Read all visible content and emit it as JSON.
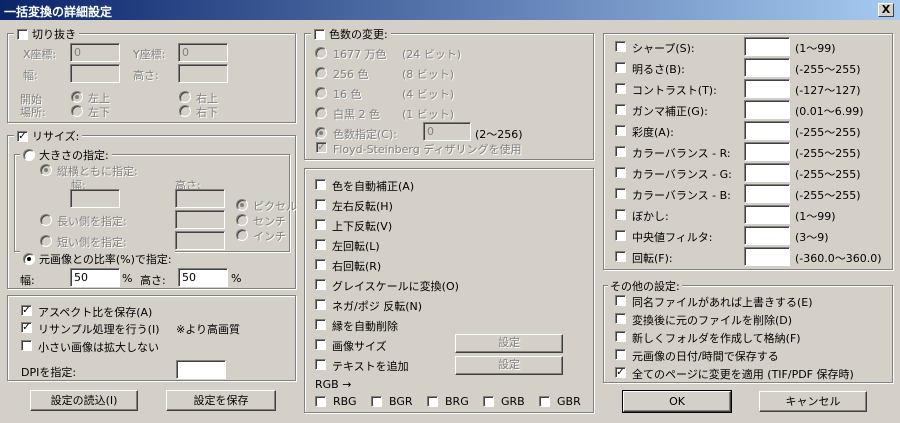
{
  "window": {
    "title": "一括変換の詳細設定",
    "close": "X"
  },
  "crop": {
    "label": "切り抜き",
    "x_label": "X座標:",
    "x_value": "0",
    "y_label": "Y座標:",
    "y_value": "0",
    "w_label": "幅:",
    "h_label": "高さ:",
    "start_label1": "開始",
    "start_label2": "場所:",
    "top_left": "左上",
    "top_right": "右上",
    "bottom_left": "左下",
    "bottom_right": "右下"
  },
  "resize": {
    "label": "リサイズ:",
    "size_spec": "大きさの指定:",
    "keep_wh": "縦横ともに指定:",
    "w_label": "幅:",
    "h_label": "高さ:",
    "long_side": "長い側を指定:",
    "short_side": "短い側を指定:",
    "unit_pixel": "ピクセル",
    "unit_cm": "センチ",
    "unit_inch": "インチ",
    "ratio_spec": "元画像との比率(%)で指定:",
    "ratio_w_label": "幅:",
    "ratio_w": "50",
    "pct1": "%",
    "ratio_h_label": "高さ:",
    "ratio_h": "50",
    "pct2": "%"
  },
  "aspect": {
    "keep_aspect": "アスペクト比を保存(A)",
    "resample": "リサンプル処理を行う(I)",
    "note": "※より高画質",
    "no_enlarge": "小さい画像は拡大しない",
    "dpi_label": "DPIを指定:",
    "dpi_value": ""
  },
  "buttons_left": {
    "load": "設定の読込(I)",
    "save": "設定を保存"
  },
  "colors": {
    "label": "色数の変更:",
    "c1677": "1677 万色",
    "c1677b": "(24 ビット)",
    "c256": "256 色",
    "c256b": "(8 ビット)",
    "c16": "16 色",
    "c16b": "(4 ビット)",
    "c2": "白黒 2 色",
    "c2b": "(1 ビット)",
    "spec": "色数指定(C):",
    "spec_value": "0",
    "spec_range": "(2〜256)",
    "floyd": "Floyd-Steinberg ディザリングを使用"
  },
  "ops": {
    "auto_color": "色を自動補正(A)",
    "flip_h": "左右反転(H)",
    "flip_v": "上下反転(V)",
    "rot_l": "左回転(L)",
    "rot_r": "右回転(R)",
    "gray": "グレイスケールに変換(O)",
    "nega": "ネガ/ポジ 反転(N)",
    "trim": "縁を自動削除",
    "img_size": "画像サイズ",
    "add_text": "テキストを追加",
    "settings": "設定",
    "rgb_label": "RGB →",
    "rbg": "RBG",
    "bgr": "BGR",
    "brg": "BRG",
    "grb": "GRB",
    "gbr": "GBR"
  },
  "adjust": [
    {
      "label": "シャープ(S):",
      "range": "(1〜99)"
    },
    {
      "label": "明るさ(B):",
      "range": "(-255〜255)"
    },
    {
      "label": "コントラスト(T):",
      "range": "(-127〜127)"
    },
    {
      "label": "ガンマ補正(G):",
      "range": "(0.01〜6.99)"
    },
    {
      "label": "彩度(A):",
      "range": "(-255〜255)"
    },
    {
      "label": "カラーバランス - R:",
      "range": "(-255〜255)"
    },
    {
      "label": "カラーバランス - G:",
      "range": "(-255〜255)"
    },
    {
      "label": "カラーバランス - B:",
      "range": "(-255〜255)"
    },
    {
      "label": "ぼかし:",
      "range": "(1〜99)"
    },
    {
      "label": "中央値フィルタ:",
      "range": "(3〜9)"
    },
    {
      "label": "回転(F):",
      "range": "(-360.0〜360.0)"
    }
  ],
  "other": {
    "label": "その他の設定:",
    "overwrite": "同名ファイルがあれば上書きする(E)",
    "delete_orig": "変換後に元のファイルを削除(D)",
    "new_folder": "新しくフォルダを作成して格納(F)",
    "keep_date": "元画像の日付/時間で保存する",
    "all_pages": "全てのページに変更を適用 (TIF/PDF 保存時)"
  },
  "dialog": {
    "ok": "OK",
    "cancel": "キャンセル"
  }
}
